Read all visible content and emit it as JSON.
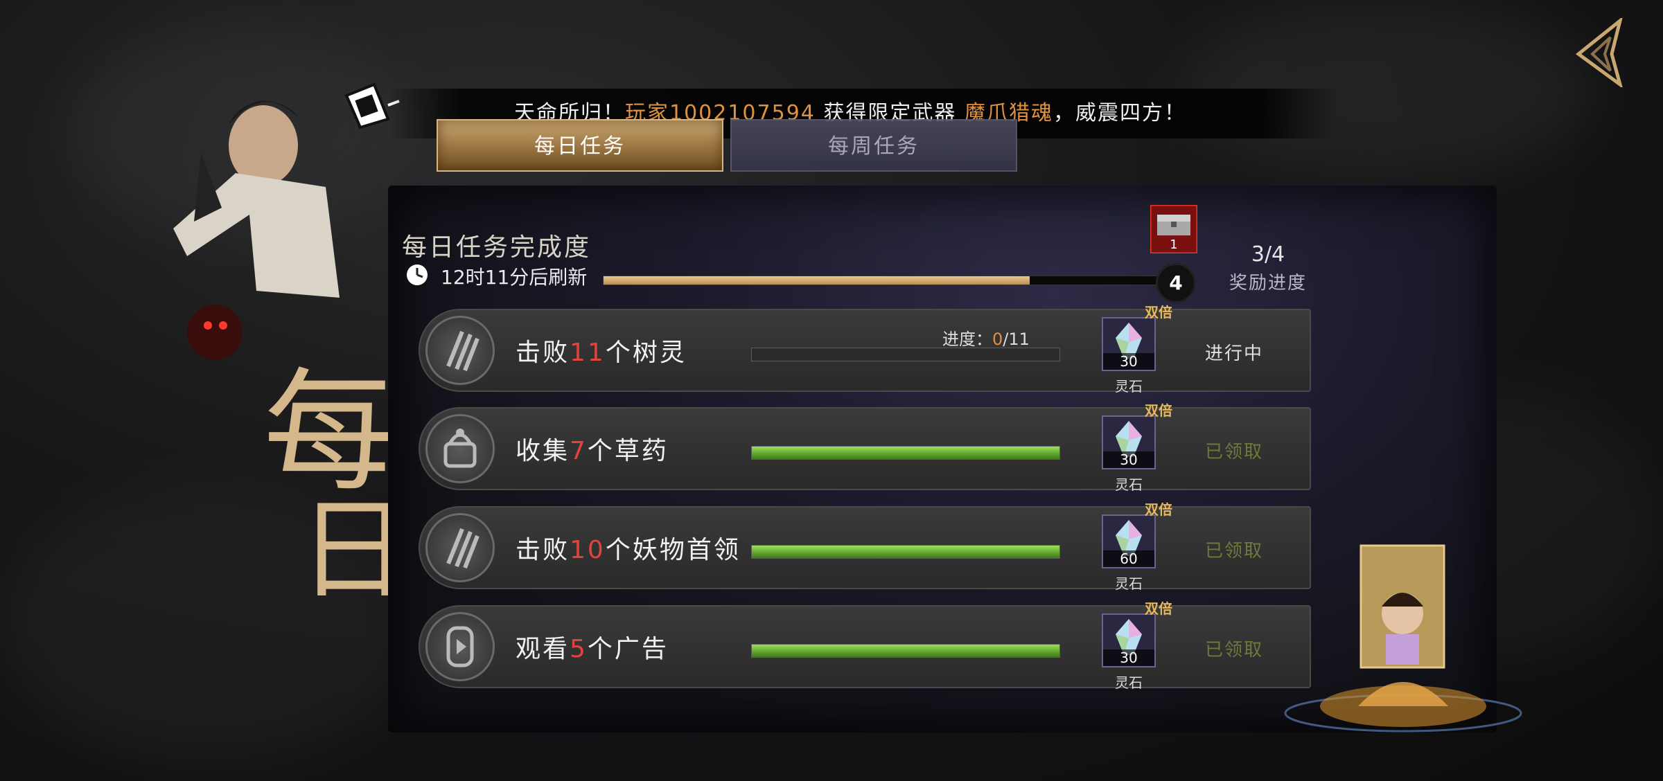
{
  "announcement": {
    "prefix": "天命所归！",
    "player": "玩家1002107594",
    "middle": " 获得限定武器 ",
    "weapon": "魔爪猎魂",
    "suffix": "，威震四方！"
  },
  "tabs": [
    {
      "label": "每日任务",
      "active": true
    },
    {
      "label": "每周任务",
      "active": false
    }
  ],
  "completion": {
    "title": "每日任务完成度",
    "refresh_text": "12时11分后刷新",
    "progress_fraction": 0.75,
    "chest_count": "1",
    "milestone": "4",
    "reward_progress": "3/4",
    "reward_progress_label": "奖励进度"
  },
  "calligraphy_text": "每日",
  "tasks": [
    {
      "name_pre": "击败",
      "num": "11",
      "name_post": "个树灵",
      "icon": "claw-icon",
      "progress_prefix": "进度：",
      "progress_current": "0",
      "progress_total": "/11",
      "progress_fraction": 0,
      "reward_count": "30",
      "reward_name": "灵石",
      "double_label": "双倍",
      "status": "进行中",
      "claimed": false
    },
    {
      "name_pre": "收集",
      "num": "7",
      "name_post": "个草药",
      "icon": "herb-basket-icon",
      "progress_fraction": 1,
      "reward_count": "30",
      "reward_name": "灵石",
      "double_label": "双倍",
      "status": "已领取",
      "claimed": true
    },
    {
      "name_pre": "击败",
      "num": "10",
      "name_post": "个妖物首领",
      "icon": "claw-icon",
      "progress_fraction": 1,
      "reward_count": "60",
      "reward_name": "灵石",
      "double_label": "双倍",
      "status": "已领取",
      "claimed": true
    },
    {
      "name_pre": "观看",
      "num": "5",
      "name_post": "个广告",
      "icon": "video-play-icon",
      "progress_fraction": 1,
      "reward_count": "30",
      "reward_name": "灵石",
      "double_label": "双倍",
      "status": "已领取",
      "claimed": true
    }
  ],
  "colors": {
    "accent_orange": "#e0913c",
    "number_red": "#e0443c",
    "progress_gold": "#c9a771",
    "progress_green": "#7cc548",
    "claimed_olive": "#6c7a3a"
  }
}
